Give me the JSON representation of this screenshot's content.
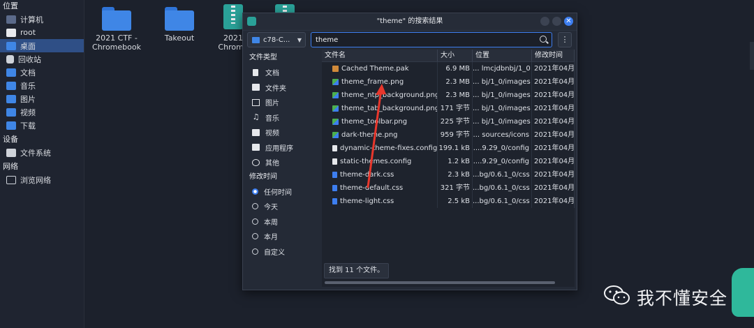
{
  "sidebar": {
    "sections": [
      {
        "title": "位置",
        "items": [
          {
            "label": "计算机",
            "icon": "computer-icon"
          },
          {
            "label": "root",
            "icon": "home-icon"
          },
          {
            "label": "桌面",
            "icon": "desktop-icon"
          },
          {
            "label": "回收站",
            "icon": "trash-icon"
          },
          {
            "label": "文档",
            "icon": "folder-icon"
          },
          {
            "label": "音乐",
            "icon": "folder-icon"
          },
          {
            "label": "图片",
            "icon": "folder-icon"
          },
          {
            "label": "视频",
            "icon": "folder-icon"
          },
          {
            "label": "下载",
            "icon": "folder-icon"
          }
        ]
      },
      {
        "title": "设备",
        "items": [
          {
            "label": "文件系统",
            "icon": "disk-icon"
          }
        ]
      },
      {
        "title": "网络",
        "items": [
          {
            "label": "浏览网络",
            "icon": "network-icon"
          }
        ]
      }
    ]
  },
  "desktop": {
    "items": [
      {
        "label1": "2021 CTF -",
        "label2": "Chromebook"
      },
      {
        "label1": "Takeout",
        "label2": ""
      },
      {
        "label1": "2021",
        "label2": "Chrome"
      }
    ]
  },
  "dialog": {
    "title": "\"theme\" 的搜索结果",
    "location": "c78-C...",
    "search_value": "theme",
    "filters": {
      "type_title": "文件类型",
      "types": [
        "文档",
        "文件夹",
        "图片",
        "音乐",
        "视频",
        "应用程序",
        "其他"
      ],
      "time_title": "修改时间",
      "times": [
        "任何时间",
        "今天",
        "本周",
        "本月",
        "自定义"
      ],
      "selected_time": "任何时间"
    },
    "columns": [
      "文件名",
      "大小",
      "位置",
      "修改时间"
    ],
    "rows": [
      {
        "name": "Cached Theme.pak",
        "size": "6.9 MB",
        "loc": "... lmcjdbnbj/1_0",
        "time": "2021年04月",
        "type": "pak"
      },
      {
        "name": "theme_frame.png",
        "size": "2.3 MB",
        "loc": "... bj/1_0/images",
        "time": "2021年04月",
        "type": "png"
      },
      {
        "name": "theme_ntp_background.png",
        "size": "2.3 MB",
        "loc": "... bj/1_0/images",
        "time": "2021年04月",
        "type": "png"
      },
      {
        "name": "theme_tab_background.png",
        "size": "171 字节",
        "loc": "... bj/1_0/images",
        "time": "2021年04月",
        "type": "png"
      },
      {
        "name": "theme_toolbar.png",
        "size": "225 字节",
        "loc": "... bj/1_0/images",
        "time": "2021年04月",
        "type": "png"
      },
      {
        "name": "dark-theme.png",
        "size": "959 字节",
        "loc": "... sources/icons",
        "time": "2021年04月",
        "type": "png"
      },
      {
        "name": "dynamic-theme-fixes.config",
        "size": "199.1 kB",
        "loc": "....9.29_0/config",
        "time": "2021年04月",
        "type": "config"
      },
      {
        "name": "static-themes.config",
        "size": "1.2 kB",
        "loc": "....9.29_0/config",
        "time": "2021年04月",
        "type": "config"
      },
      {
        "name": "theme-dark.css",
        "size": "2.3 kB",
        "loc": "...bg/0.6.1_0/css",
        "time": "2021年04月",
        "type": "css"
      },
      {
        "name": "theme-default.css",
        "size": "321 字节",
        "loc": "...bg/0.6.1_0/css",
        "time": "2021年04月",
        "type": "css"
      },
      {
        "name": "theme-light.css",
        "size": "2.5 kB",
        "loc": "...bg/0.6.1_0/css",
        "time": "2021年04月",
        "type": "css"
      }
    ],
    "status": "找到 11 个文件。"
  },
  "watermark": {
    "text": "我不懂安全"
  },
  "colors": {
    "accent": "#3d7ef0",
    "background": "#1c212c",
    "folder": "#3f86e6",
    "arrow": "#e8372c"
  }
}
